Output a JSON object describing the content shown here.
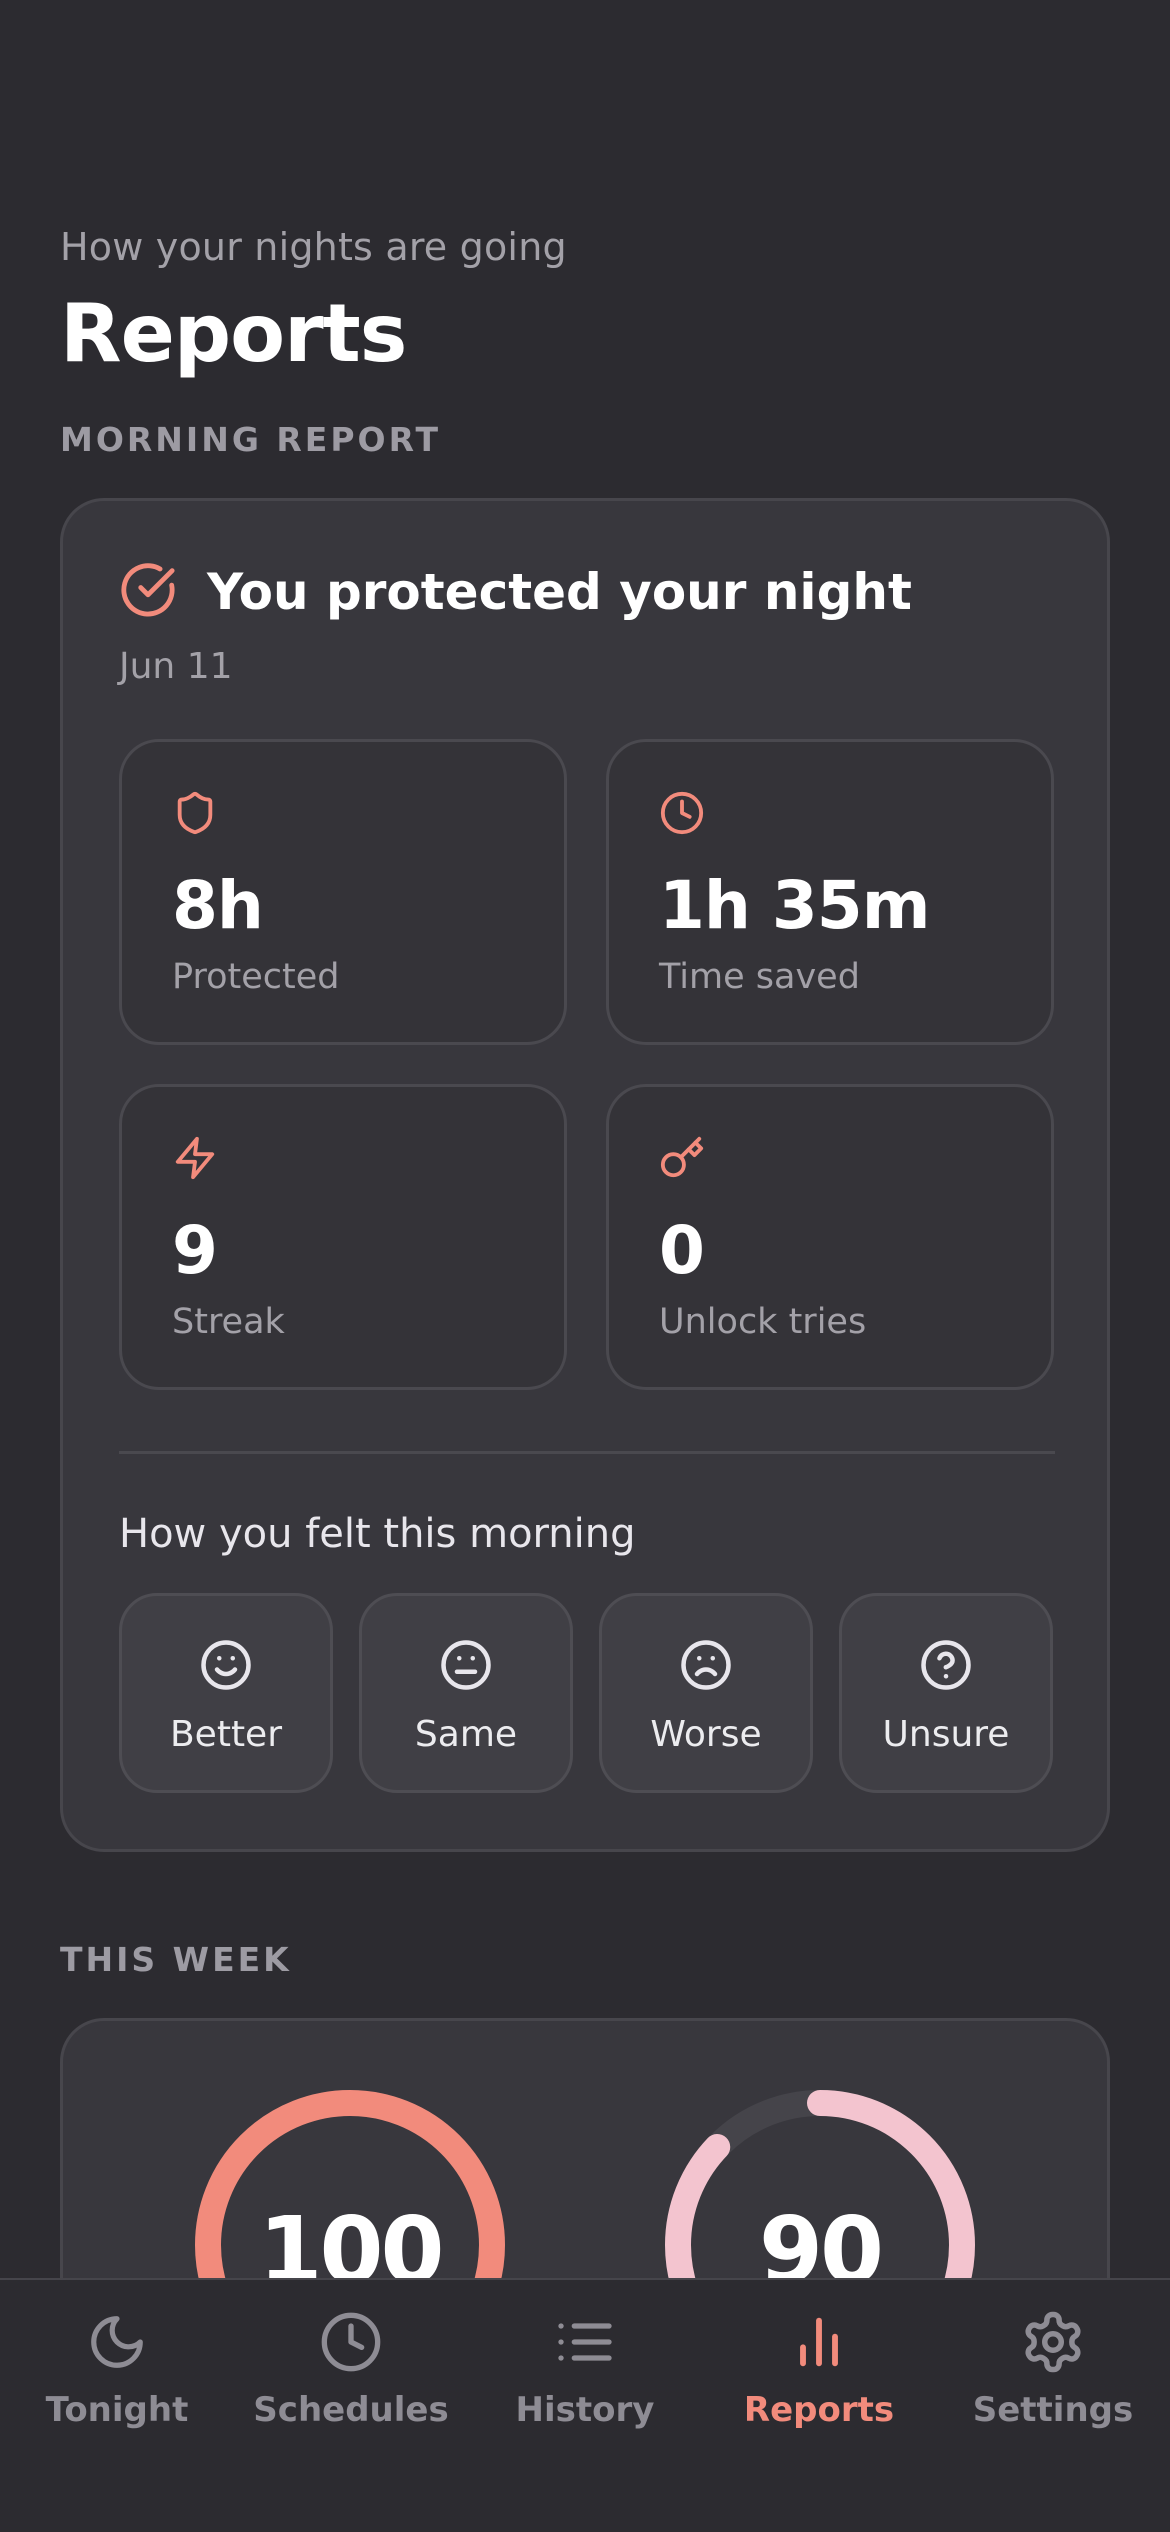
{
  "header": {
    "subtitle": "How your nights are going",
    "title": "Reports"
  },
  "morning_report": {
    "section_label": "MORNING REPORT",
    "title": "You protected your night",
    "date": "Jun 11",
    "stats": [
      {
        "icon": "shield-icon",
        "value": "8h",
        "label": "Protected"
      },
      {
        "icon": "clock-icon",
        "value": "1h 35m",
        "label": "Time saved"
      },
      {
        "icon": "lightning-icon",
        "value": "9",
        "label": "Streak"
      },
      {
        "icon": "key-icon",
        "value": "0",
        "label": "Unlock tries"
      }
    ],
    "felt_title": "How you felt this morning",
    "moods": [
      {
        "icon": "smile-icon",
        "label": "Better"
      },
      {
        "icon": "neutral-face-icon",
        "label": "Same"
      },
      {
        "icon": "frown-icon",
        "label": "Worse"
      },
      {
        "icon": "question-icon",
        "label": "Unsure"
      }
    ]
  },
  "this_week": {
    "section_label": "THIS WEEK",
    "rings": [
      {
        "value": "100",
        "progress": 1.0,
        "color": "#f28b7c"
      },
      {
        "value": "90",
        "progress": 0.9,
        "color": "#f3c4cf"
      }
    ]
  },
  "tabbar": {
    "tabs": [
      {
        "icon": "moon-icon",
        "label": "Tonight",
        "active": false
      },
      {
        "icon": "clock-icon",
        "label": "Schedules",
        "active": false
      },
      {
        "icon": "list-icon",
        "label": "History",
        "active": false
      },
      {
        "icon": "bar-chart-icon",
        "label": "Reports",
        "active": true
      },
      {
        "icon": "gear-icon",
        "label": "Settings",
        "active": false
      }
    ]
  },
  "colors": {
    "accent": "#f28b7c",
    "background": "#2c2b30",
    "card": "#38373d",
    "muted_text": "#a3a1a8"
  }
}
